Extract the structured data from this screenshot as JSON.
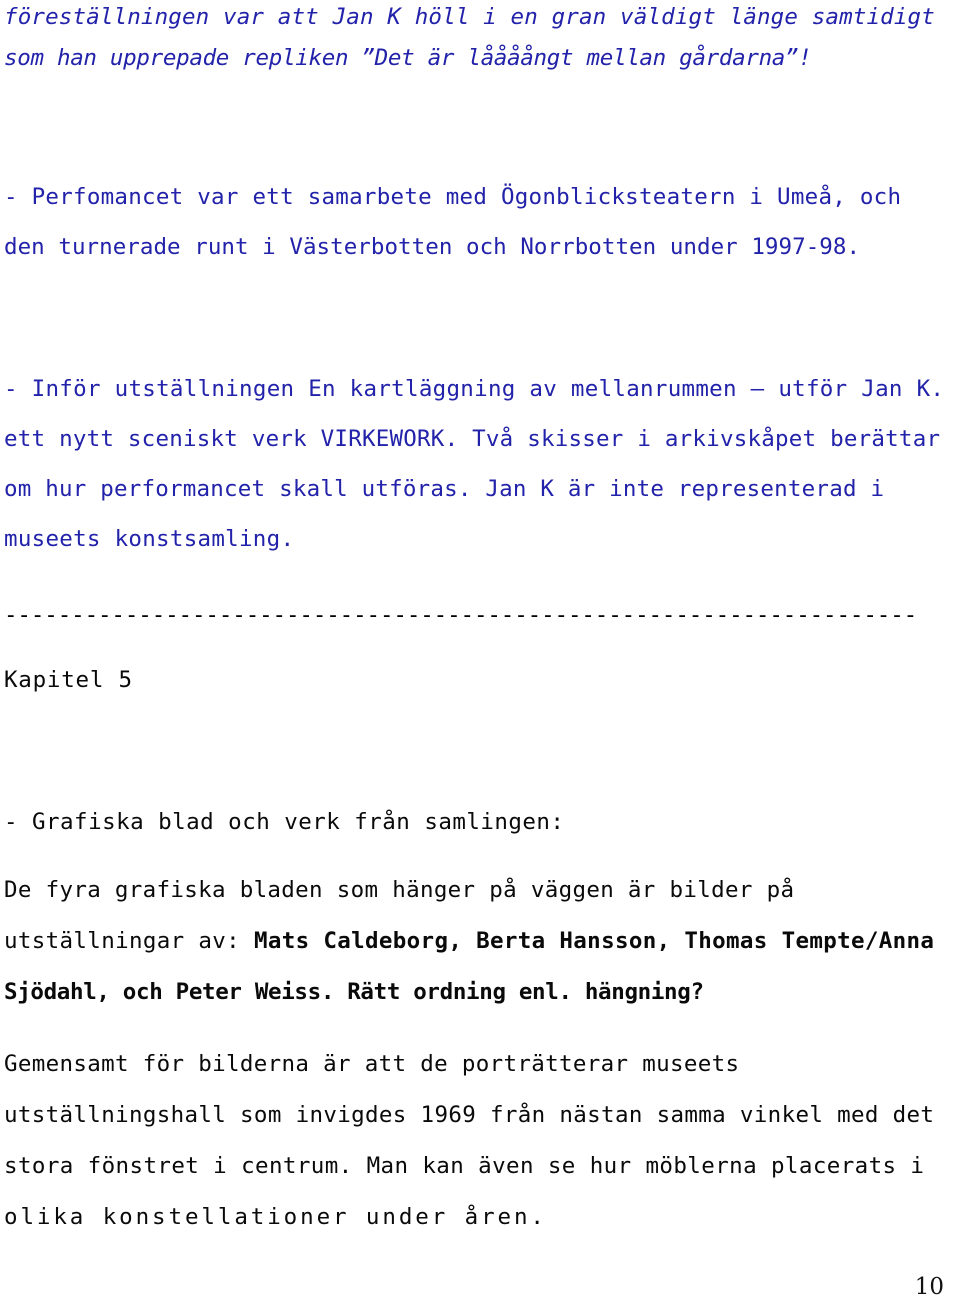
{
  "page": {
    "number": "10",
    "background_color": "#ffffff",
    "blue_text_color": "#2222aa",
    "black_text_color": "#0a0a0a"
  },
  "blocks": {
    "opening_quote": {
      "style": "blue-italic",
      "lines": [
        "föreställningen var att Jan K höll i en gran väldigt länge samtidigt",
        "som han upprepade repliken ”Det är låååångt mellan gårdarna”!"
      ]
    },
    "paragraph_performance": {
      "style": "blue",
      "lines": [
        "- Perfomancet var ett samarbete med Ögonblicksteatern i Umeå, och",
        "den turnerade runt i Västerbotten och Norrbotten under 1997-98."
      ]
    },
    "paragraph_exhibition": {
      "style": "blue",
      "lines": [
        "- Inför utställningen En kartläggning av mellanrummen — utför Jan K.",
        "ett nytt sceniskt verk VIRKEWORK. Två skisser i arkivskåpet berättar",
        "om hur performancet skall utföras. Jan K är inte representerad i",
        "museets konstsamling."
      ]
    },
    "separator": {
      "style": "black",
      "text": "--------------------------------------------------------------------"
    },
    "chapter_heading": {
      "style": "black",
      "text": "Kapitel 5"
    },
    "section_heading": {
      "style": "black",
      "text": "- Grafiska blad och verk från samlingen:"
    },
    "paragraph_prints": {
      "style": "black",
      "line1": "De fyra grafiska bladen som hänger på väggen är bilder på",
      "line2_plain": "utställningar av: ",
      "line2_bold": "Mats Caldeborg, Berta Hansson, Thomas Tempte/Anna",
      "line3_bold": "Sjödahl, och Peter Weiss. Rätt ordning enl. hängning?"
    },
    "paragraph_common": {
      "style": "black",
      "lines": [
        "Gemensamt för bilderna är att de porträtterar museets",
        "utställningshall som invigdes 1969 från nästan samma vinkel med det",
        "stora fönstret i centrum. Man kan även se hur möblerna placerats i",
        "olika konstellationer under åren."
      ]
    }
  }
}
